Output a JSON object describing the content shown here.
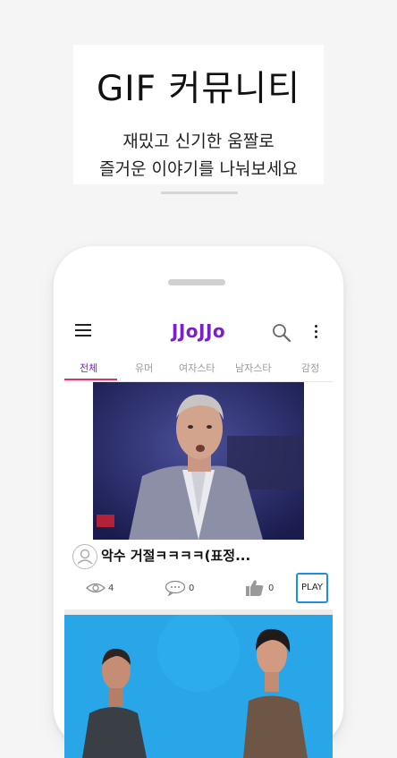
{
  "promo": {
    "title": "GIF 커뮤니티",
    "subtitle_line1": "재밌고 신기한 움짤로",
    "subtitle_line2": "즐거운 이야기를 나눠보세요"
  },
  "app": {
    "logo": "JJoJJo",
    "brand_color": "#7b1fc9",
    "tabs": [
      {
        "label": "전체",
        "active": true
      },
      {
        "label": "유머",
        "active": false
      },
      {
        "label": "여자스타",
        "active": false
      },
      {
        "label": "남자스타",
        "active": false
      },
      {
        "label": "감정",
        "active": false
      }
    ]
  },
  "feed": {
    "posts": [
      {
        "title": "악수 거절ㅋㅋㅋㅋ(표정...",
        "views": "4",
        "comments": "0",
        "likes": "0",
        "play_label": "PLAY"
      }
    ]
  },
  "icons": [
    "hamburger-menu-icon",
    "search-icon",
    "more-vertical-icon",
    "user-avatar-icon",
    "eye-icon",
    "comment-icon",
    "thumbs-up-icon"
  ]
}
